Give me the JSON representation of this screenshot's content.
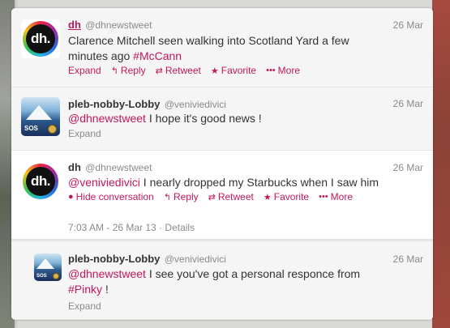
{
  "tweets": [
    {
      "name": "dh",
      "handle": "@dhnewstweet",
      "date": "26 Mar",
      "text_parts": [
        "Clarence Mitchell seen walking into Scotland Yard a few minutes ago ",
        "#McCann"
      ],
      "actions": {
        "expand": "Expand",
        "reply": "Reply",
        "retweet": "Retweet",
        "favorite": "Favorite",
        "more": "More"
      }
    },
    {
      "name": "pleb-nobby-Lobby",
      "handle": "@veniviedivici",
      "date": "26 Mar",
      "mention": "@dhnewstweet",
      "text": " I hope it's good news !",
      "expand": "Expand"
    },
    {
      "name": "dh",
      "handle": "@dhnewstweet",
      "date": "26 Mar",
      "mention": "@veniviedivici",
      "text": " I nearly dropped my Starbucks when I saw him",
      "actions": {
        "hide": "Hide conversation",
        "reply": "Reply",
        "retweet": "Retweet",
        "favorite": "Favorite",
        "more": "More"
      },
      "timestamp": "7:03 AM - 26 Mar 13",
      "separator": "·",
      "details": "Details"
    },
    {
      "name": "pleb-nobby-Lobby",
      "handle": "@veniviedivici",
      "date": "26 Mar",
      "mention": "@dhnewstweet",
      "text": " I see you've got a personal responce from ",
      "hashtag": "#Pinky",
      "text_end": " !",
      "expand": "Expand"
    }
  ],
  "avatars": {
    "dh_logo_text": "dh.",
    "sos_text": "SOS"
  },
  "colors": {
    "accent": "#c2185b",
    "muted": "#8a8a8a",
    "text": "#333333"
  },
  "icons": {
    "reply": "reply-arrow-icon",
    "retweet": "retweet-icon",
    "favorite": "star-icon",
    "more": "ellipsis-icon",
    "hide": "speech-bubble-icon"
  }
}
